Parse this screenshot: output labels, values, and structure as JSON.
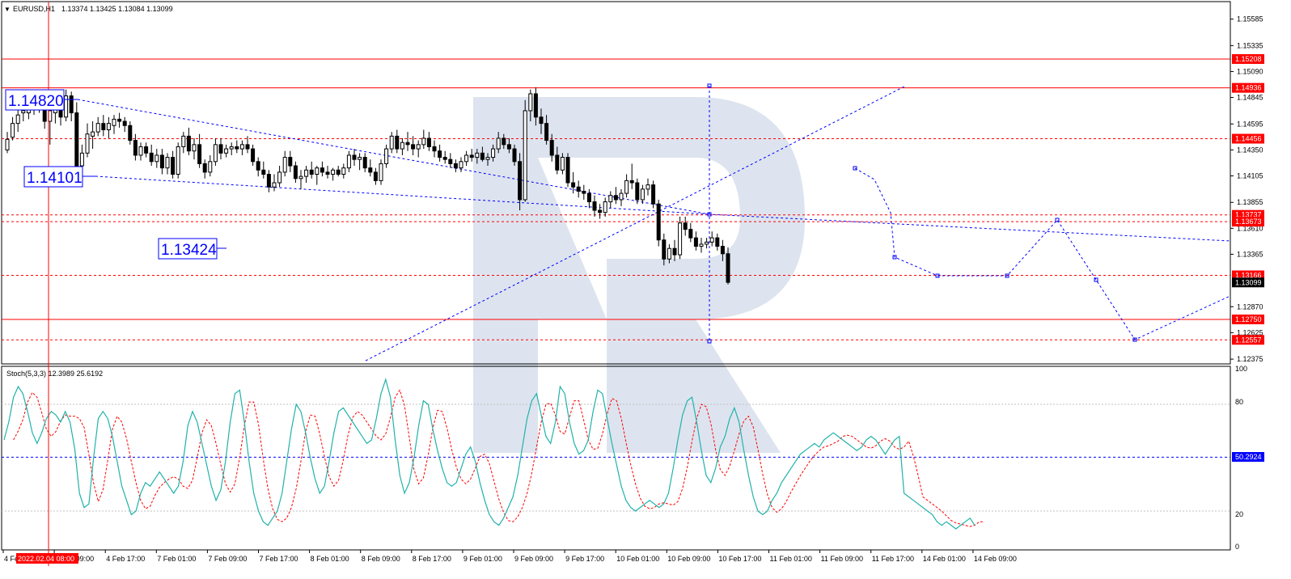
{
  "colors": {
    "background": "#ffffff",
    "grid": "#c0c0c0",
    "candle": "#000000",
    "hline": "#ff0000",
    "blue": "#0000ff",
    "stoch_main": "#20b2aa",
    "stoch_signal": "#ff0000",
    "label_red": "#ff0000",
    "label_black": "#000000",
    "label_blue": "#0000ff",
    "watermark": "#dde4ef"
  },
  "header": {
    "symbol_menu": "▼",
    "symbol": "EURUSD,H1",
    "ohlc": "1.13374 1.13425 1.13084 1.13099"
  },
  "stoch": {
    "header": "Stoch(5,3,3) 12.3989 25.6192",
    "level_label": "50.2924",
    "axis_ticks": [
      "100",
      "80",
      "20",
      "0"
    ]
  },
  "xaxis": {
    "labels": [
      "4 Feb 2022",
      "4 Feb 09:00",
      "4 Feb 17:00",
      "7 Feb 01:00",
      "7 Feb 09:00",
      "7 Feb 17:00",
      "8 Feb 01:00",
      "8 Feb 09:00",
      "8 Feb 17:00",
      "9 Feb 01:00",
      "9 Feb 09:00",
      "9 Feb 17:00",
      "10 Feb 01:00",
      "10 Feb 09:00",
      "10 Feb 17:00",
      "11 Feb 01:00",
      "11 Feb 09:00",
      "11 Feb 17:00",
      "14 Feb 01:00",
      "14 Feb 09:00"
    ],
    "crosshair_label": "2022.02.04 08:00"
  },
  "price_labels": {
    "ticks": [
      "1.15585",
      "1.15335",
      "1.15090",
      "1.14845",
      "1.14595",
      "1.14350",
      "1.14105",
      "1.13855",
      "1.13610",
      "1.13365",
      "1.12870",
      "1.12625",
      "1.12375"
    ],
    "levels": [
      {
        "value": "1.15208",
        "style": "solid",
        "label_color": "red"
      },
      {
        "value": "1.14936",
        "style": "solid",
        "label_color": "red"
      },
      {
        "value": "1.14456",
        "style": "dashed",
        "label_color": "red"
      },
      {
        "value": "1.13737",
        "style": "dashed",
        "label_color": "red"
      },
      {
        "value": "1.13673",
        "style": "dashed",
        "label_color": "red"
      },
      {
        "value": "1.13166",
        "style": "dashed",
        "label_color": "red"
      },
      {
        "value": "1.13099",
        "style": "none",
        "label_color": "black"
      },
      {
        "value": "1.12750",
        "style": "solid",
        "label_color": "red"
      },
      {
        "value": "1.12557",
        "style": "dashed",
        "label_color": "red"
      }
    ]
  },
  "annotations": [
    "1.14820",
    "1.14101",
    "1.13424"
  ],
  "chart_data": {
    "type": "candlestick",
    "symbol": "EURUSD",
    "timeframe": "H1",
    "ylim": [
      1.1233,
      1.1575
    ],
    "candles": [
      [
        1.1435,
        1.1452,
        1.1432,
        1.1445
      ],
      [
        1.1447,
        1.1466,
        1.1444,
        1.146
      ],
      [
        1.146,
        1.1475,
        1.1452,
        1.1468
      ],
      [
        1.147,
        1.148,
        1.1462,
        1.1472
      ],
      [
        1.147,
        1.1482,
        1.1464,
        1.1476
      ],
      [
        1.1476,
        1.1486,
        1.1468,
        1.1482
      ],
      [
        1.148,
        1.1488,
        1.147,
        1.1478
      ],
      [
        1.1476,
        1.1485,
        1.1455,
        1.1462
      ],
      [
        1.1462,
        1.148,
        1.144,
        1.1472
      ],
      [
        1.147,
        1.1484,
        1.146,
        1.1478
      ],
      [
        1.1476,
        1.1482,
        1.1458,
        1.1466
      ],
      [
        1.1466,
        1.1492,
        1.1462,
        1.1486
      ],
      [
        1.1486,
        1.149,
        1.1462,
        1.147
      ],
      [
        1.147,
        1.148,
        1.141,
        1.142
      ],
      [
        1.142,
        1.144,
        1.1412,
        1.1432
      ],
      [
        1.1432,
        1.146,
        1.1428,
        1.145
      ],
      [
        1.1448,
        1.1462,
        1.1436,
        1.1452
      ],
      [
        1.1452,
        1.1466,
        1.1448,
        1.146
      ],
      [
        1.146,
        1.1468,
        1.1448,
        1.1454
      ],
      [
        1.1454,
        1.1466,
        1.1446,
        1.146
      ],
      [
        1.1458,
        1.1468,
        1.145,
        1.1464
      ],
      [
        1.1464,
        1.147,
        1.1456,
        1.1462
      ],
      [
        1.1462,
        1.1466,
        1.1452,
        1.1458
      ],
      [
        1.1458,
        1.1462,
        1.144,
        1.1444
      ],
      [
        1.1444,
        1.145,
        1.1425,
        1.143
      ],
      [
        1.143,
        1.1442,
        1.1425,
        1.1438
      ],
      [
        1.1438,
        1.1442,
        1.1428,
        1.1432
      ],
      [
        1.1432,
        1.144,
        1.142,
        1.1424
      ],
      [
        1.1424,
        1.1436,
        1.1418,
        1.143
      ],
      [
        1.143,
        1.1436,
        1.1412,
        1.1418
      ],
      [
        1.1418,
        1.1432,
        1.1412,
        1.1428
      ],
      [
        1.1428,
        1.1434,
        1.1408,
        1.1412
      ],
      [
        1.1412,
        1.1442,
        1.1408,
        1.1438
      ],
      [
        1.1438,
        1.1452,
        1.1432,
        1.1448
      ],
      [
        1.1448,
        1.1456,
        1.143,
        1.1434
      ],
      [
        1.1434,
        1.1446,
        1.1426,
        1.144
      ],
      [
        1.144,
        1.145,
        1.1418,
        1.1422
      ],
      [
        1.1422,
        1.1426,
        1.1408,
        1.1414
      ],
      [
        1.1414,
        1.143,
        1.141,
        1.1424
      ],
      [
        1.1424,
        1.1446,
        1.142,
        1.144
      ],
      [
        1.144,
        1.1446,
        1.1426,
        1.1432
      ],
      [
        1.1432,
        1.144,
        1.1428,
        1.1436
      ],
      [
        1.1436,
        1.1442,
        1.143,
        1.1438
      ],
      [
        1.1438,
        1.1444,
        1.1432,
        1.1436
      ],
      [
        1.1436,
        1.1444,
        1.143,
        1.144
      ],
      [
        1.144,
        1.1448,
        1.1432,
        1.1436
      ],
      [
        1.1436,
        1.144,
        1.142,
        1.1424
      ],
      [
        1.1424,
        1.1428,
        1.141,
        1.1416
      ],
      [
        1.1416,
        1.1424,
        1.1408,
        1.1412
      ],
      [
        1.1412,
        1.1416,
        1.1395,
        1.14
      ],
      [
        1.14,
        1.1412,
        1.1396,
        1.1404
      ],
      [
        1.1404,
        1.142,
        1.14,
        1.1414
      ],
      [
        1.1414,
        1.1434,
        1.141,
        1.1428
      ],
      [
        1.1428,
        1.1434,
        1.1414,
        1.142
      ],
      [
        1.142,
        1.1424,
        1.1404,
        1.1408
      ],
      [
        1.1408,
        1.1416,
        1.1398,
        1.141
      ],
      [
        1.141,
        1.142,
        1.1404,
        1.1416
      ],
      [
        1.1416,
        1.1424,
        1.1408,
        1.1412
      ],
      [
        1.1412,
        1.142,
        1.1402,
        1.1418
      ],
      [
        1.1418,
        1.1424,
        1.141,
        1.1414
      ],
      [
        1.1414,
        1.142,
        1.1408,
        1.1412
      ],
      [
        1.1412,
        1.1418,
        1.1406,
        1.1416
      ],
      [
        1.1416,
        1.142,
        1.141,
        1.1412
      ],
      [
        1.1412,
        1.1422,
        1.1408,
        1.1418
      ],
      [
        1.1418,
        1.1434,
        1.1414,
        1.143
      ],
      [
        1.143,
        1.1436,
        1.142,
        1.1426
      ],
      [
        1.1426,
        1.1432,
        1.1416,
        1.1428
      ],
      [
        1.1428,
        1.1432,
        1.1414,
        1.1418
      ],
      [
        1.1418,
        1.1426,
        1.141,
        1.1414
      ],
      [
        1.1414,
        1.1418,
        1.1402,
        1.1406
      ],
      [
        1.1406,
        1.1426,
        1.1402,
        1.1422
      ],
      [
        1.1422,
        1.144,
        1.1418,
        1.1436
      ],
      [
        1.1436,
        1.1452,
        1.1432,
        1.1448
      ],
      [
        1.1448,
        1.1454,
        1.1432,
        1.1436
      ],
      [
        1.1436,
        1.1446,
        1.143,
        1.1442
      ],
      [
        1.1442,
        1.1452,
        1.1434,
        1.144
      ],
      [
        1.144,
        1.1448,
        1.143,
        1.1436
      ],
      [
        1.1436,
        1.1444,
        1.1428,
        1.144
      ],
      [
        1.144,
        1.1454,
        1.1436,
        1.1446
      ],
      [
        1.1446,
        1.1452,
        1.1434,
        1.1438
      ],
      [
        1.1438,
        1.1444,
        1.1428,
        1.1434
      ],
      [
        1.1434,
        1.144,
        1.1424,
        1.1428
      ],
      [
        1.1428,
        1.1434,
        1.1422,
        1.1426
      ],
      [
        1.1426,
        1.1432,
        1.1418,
        1.1422
      ],
      [
        1.1422,
        1.1426,
        1.1414,
        1.1418
      ],
      [
        1.1418,
        1.1428,
        1.1414,
        1.1424
      ],
      [
        1.1424,
        1.1434,
        1.142,
        1.143
      ],
      [
        1.143,
        1.1436,
        1.1424,
        1.1428
      ],
      [
        1.1428,
        1.1436,
        1.1422,
        1.1432
      ],
      [
        1.1432,
        1.1438,
        1.1424,
        1.1426
      ],
      [
        1.1426,
        1.1432,
        1.142,
        1.1428
      ],
      [
        1.1428,
        1.144,
        1.1424,
        1.1436
      ],
      [
        1.1436,
        1.1452,
        1.1432,
        1.1446
      ],
      [
        1.1446,
        1.145,
        1.1436,
        1.144
      ],
      [
        1.144,
        1.1446,
        1.1432,
        1.1436
      ],
      [
        1.1436,
        1.144,
        1.142,
        1.1424
      ],
      [
        1.1424,
        1.1432,
        1.1378,
        1.1388
      ],
      [
        1.1388,
        1.1482,
        1.1386,
        1.1472
      ],
      [
        1.1472,
        1.1492,
        1.1462,
        1.1488
      ],
      [
        1.1488,
        1.1494,
        1.1458,
        1.1466
      ],
      [
        1.1466,
        1.1474,
        1.145,
        1.146
      ],
      [
        1.146,
        1.1468,
        1.144,
        1.1444
      ],
      [
        1.1444,
        1.145,
        1.1424,
        1.143
      ],
      [
        1.143,
        1.1438,
        1.1412,
        1.1416
      ],
      [
        1.1416,
        1.1432,
        1.1412,
        1.1428
      ],
      [
        1.1428,
        1.1432,
        1.14,
        1.1404
      ],
      [
        1.1404,
        1.1414,
        1.1394,
        1.14
      ],
      [
        1.14,
        1.1406,
        1.139,
        1.1396
      ],
      [
        1.1396,
        1.1402,
        1.1388,
        1.1394
      ],
      [
        1.1394,
        1.1398,
        1.138,
        1.1386
      ],
      [
        1.1386,
        1.1392,
        1.1372,
        1.1378
      ],
      [
        1.1378,
        1.1384,
        1.137,
        1.1376
      ],
      [
        1.1376,
        1.139,
        1.1372,
        1.1386
      ],
      [
        1.1386,
        1.1396,
        1.138,
        1.1392
      ],
      [
        1.1392,
        1.14,
        1.1384,
        1.1388
      ],
      [
        1.1388,
        1.1398,
        1.1382,
        1.1394
      ],
      [
        1.1394,
        1.1412,
        1.139,
        1.1406
      ],
      [
        1.1406,
        1.1422,
        1.1398,
        1.1404
      ],
      [
        1.1404,
        1.1408,
        1.1384,
        1.1388
      ],
      [
        1.1388,
        1.1402,
        1.1384,
        1.1398
      ],
      [
        1.1398,
        1.1408,
        1.1392,
        1.1402
      ],
      [
        1.1402,
        1.1406,
        1.138,
        1.1384
      ],
      [
        1.1384,
        1.1388,
        1.1344,
        1.135
      ],
      [
        1.135,
        1.1356,
        1.1326,
        1.1332
      ],
      [
        1.1332,
        1.1346,
        1.1328,
        1.1342
      ],
      [
        1.1342,
        1.135,
        1.133,
        1.1336
      ],
      [
        1.1336,
        1.1372,
        1.1332,
        1.1366
      ],
      [
        1.1366,
        1.1372,
        1.1354,
        1.136
      ],
      [
        1.136,
        1.1366,
        1.1348,
        1.1352
      ],
      [
        1.1352,
        1.1358,
        1.134,
        1.1344
      ],
      [
        1.1344,
        1.1352,
        1.1338,
        1.1346
      ],
      [
        1.1346,
        1.1352,
        1.1342,
        1.1348
      ],
      [
        1.1348,
        1.1358,
        1.1344,
        1.1352
      ],
      [
        1.1352,
        1.1356,
        1.134,
        1.1344
      ],
      [
        1.1344,
        1.135,
        1.133,
        1.1337
      ],
      [
        1.1337,
        1.1343,
        1.1308,
        1.131
      ]
    ],
    "stochastic": {
      "name": "Stoch(5,3,3)",
      "main_last": 12.3989,
      "signal_last": 25.6192,
      "levels": [
        80,
        20,
        50.2924
      ],
      "ylim": [
        0,
        100
      ],
      "main": [
        60,
        70,
        84,
        90,
        86,
        76,
        64,
        58,
        64,
        72,
        76,
        74,
        70,
        76,
        70,
        55,
        30,
        22,
        24,
        50,
        72,
        76,
        72,
        62,
        48,
        34,
        26,
        18,
        20,
        30,
        36,
        34,
        38,
        42,
        38,
        34,
        30,
        34,
        48,
        68,
        76,
        70,
        58,
        46,
        34,
        26,
        32,
        48,
        70,
        86,
        88,
        70,
        48,
        30,
        20,
        14,
        12,
        16,
        20,
        30,
        48,
        66,
        80,
        76,
        64,
        50,
        38,
        30,
        34,
        48,
        64,
        76,
        78,
        74,
        70,
        66,
        62,
        58,
        60,
        72,
        86,
        94,
        84,
        60,
        40,
        30,
        36,
        50,
        68,
        82,
        80,
        66,
        54,
        44,
        36,
        34,
        36,
        44,
        52,
        56,
        48,
        36,
        26,
        18,
        14,
        12,
        16,
        22,
        28,
        40,
        56,
        72,
        82,
        86,
        74,
        62,
        58,
        70,
        90,
        86,
        70,
        58,
        52,
        54,
        60,
        76,
        88,
        86,
        72,
        58,
        46,
        34,
        26,
        22,
        20,
        22,
        24,
        26,
        24,
        22,
        24,
        30,
        44,
        60,
        74,
        82,
        84,
        70,
        54,
        40,
        36,
        44,
        56,
        62,
        72,
        78,
        70,
        54,
        40,
        28,
        20,
        18,
        20,
        26,
        30,
        36,
        40,
        44,
        48,
        52,
        54,
        56,
        58,
        56,
        60,
        62,
        64,
        62,
        60,
        58,
        56,
        54,
        56,
        60,
        62,
        60,
        56,
        52,
        56,
        60,
        62,
        30,
        28,
        26,
        24,
        22,
        20,
        18,
        14,
        12,
        14,
        12,
        10,
        12,
        14,
        16,
        12
      ]
    }
  }
}
